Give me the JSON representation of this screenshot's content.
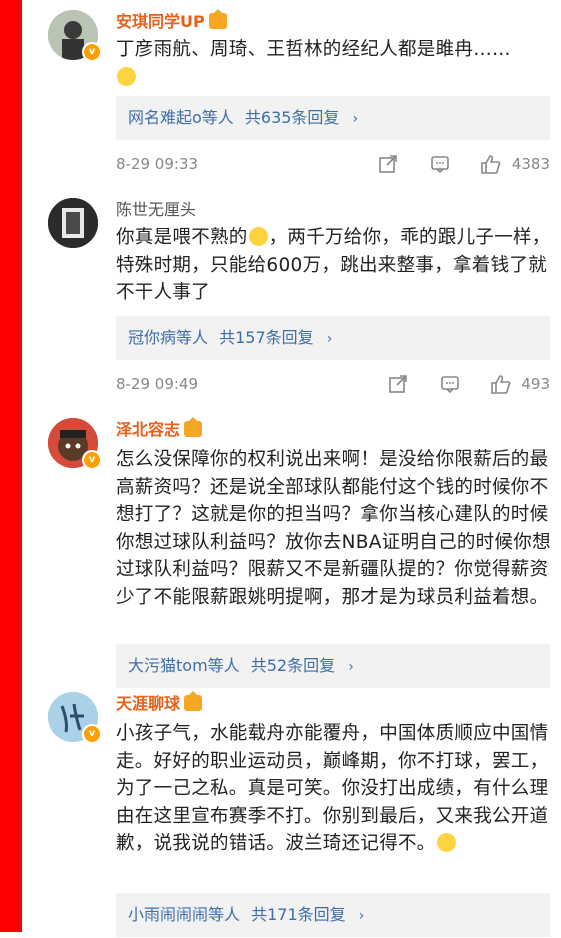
{
  "comments": [
    {
      "username": "安琪同学UP",
      "text_parts": [
        "丁彦雨航、周琦、王哲林的经纪人都是雎冉……"
      ],
      "reply_users": "网名难起o等人",
      "reply_count": "共635条回复",
      "date": "8-29 09:33",
      "likes": "4383"
    },
    {
      "username": "陈世无厘头",
      "text_parts": [
        "你真是喂不熟的",
        "，两千万给你，乖的跟儿子一样，特殊时期，只能给600万，跳出来整事，拿着钱了就不干人事了"
      ],
      "reply_users": "冠你病等人",
      "reply_count": "共157条回复",
      "date": "8-29 09:49",
      "likes": "493"
    },
    {
      "username": "泽北容志",
      "text_parts": [
        "怎么没保障你的权利说出来啊！是没给你限薪后的最高薪资吗？还是说全部球队都能付这个钱的时候你不想打了？这就是你的担当吗？拿你当核心建队的时候你想过球队利益吗？放你去NBA证明自己的时候你想过球队利益吗？限薪又不是新疆队提的？你觉得薪资少了不能限薪跟姚明提啊，那才是为球员利益着想。"
      ],
      "reply_users": "大污猫tom等人",
      "reply_count": "共52条回复"
    },
    {
      "username": "天涯聊球",
      "text_parts": [
        "小孩子气，水能载舟亦能覆舟，中国体质顺应中国情走。好好的职业运动员，巅峰期，你不打球，罢工，为了一己之私。真是可笑。你没打出成绩，有什么理由在这里宣布赛季不打。你别到最后，又来我公开道歉，说我说的错话。波兰琦还记得不。"
      ],
      "reply_users": "小雨闹闹闹等人",
      "reply_count": "共171条回复"
    }
  ],
  "chevron": "›",
  "verified_badge": "v",
  "icons": [
    "share-icon",
    "comment-icon",
    "like-icon",
    "emoji-icon",
    "crown-badge-icon"
  ],
  "colors": {
    "left_bar": "#ff0000",
    "username_orange": "#e8611a",
    "reply_link": "#3d6ea8",
    "reply_bg": "#f2f2f2"
  }
}
